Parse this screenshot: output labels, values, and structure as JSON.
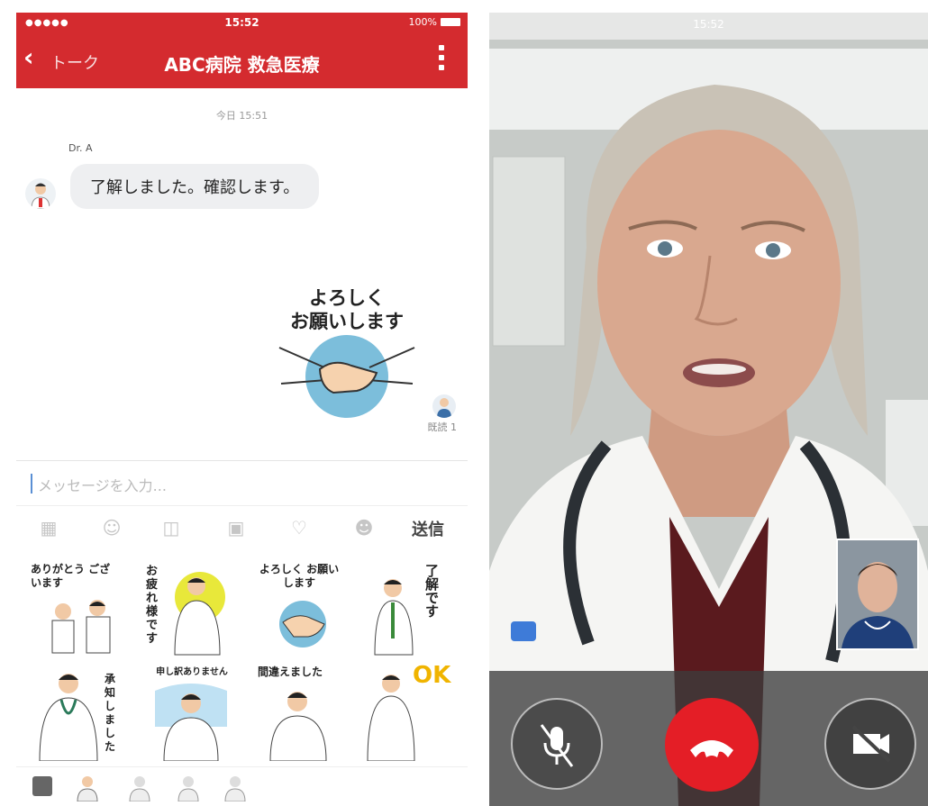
{
  "chat": {
    "status": {
      "signal": "●●●●●",
      "time": "15:52",
      "battery": "100%"
    },
    "header": {
      "back_label": "トーク",
      "title": "ABC病院 救急医療"
    },
    "date_label": "今日 15:51",
    "incoming": {
      "sender": "Dr. A",
      "text": "了解しました。確認します。"
    },
    "outgoing_sticker": {
      "line1": "よろしく",
      "line2": "お願いします",
      "read_label": "既読 1"
    },
    "input": {
      "placeholder": "メッセージを入力..."
    },
    "toolbar": {
      "icons": [
        "keyboard-icon",
        "smile-icon",
        "camera-icon",
        "image-icon",
        "heart-icon",
        "emoji-icon"
      ],
      "send_label": "送信"
    },
    "stickers": [
      {
        "caption": "ありがとう ございます"
      },
      {
        "caption": "お疲れ様です"
      },
      {
        "caption": "よろしく お願いします"
      },
      {
        "caption": "了解です"
      },
      {
        "caption": "承知しました"
      },
      {
        "caption": "申し訳ありません"
      },
      {
        "caption": "間違えました"
      },
      {
        "caption": "OK"
      }
    ],
    "colors": {
      "brand": "#d42b2f",
      "bubble": "#eeeff1",
      "accent": "#5a8fd4"
    }
  },
  "video": {
    "controls": {
      "mute_icon": "mic-off-icon",
      "end_icon": "hang-up-icon",
      "camera_icon": "camera-off-icon"
    },
    "colors": {
      "end_call": "#e41e26"
    }
  }
}
